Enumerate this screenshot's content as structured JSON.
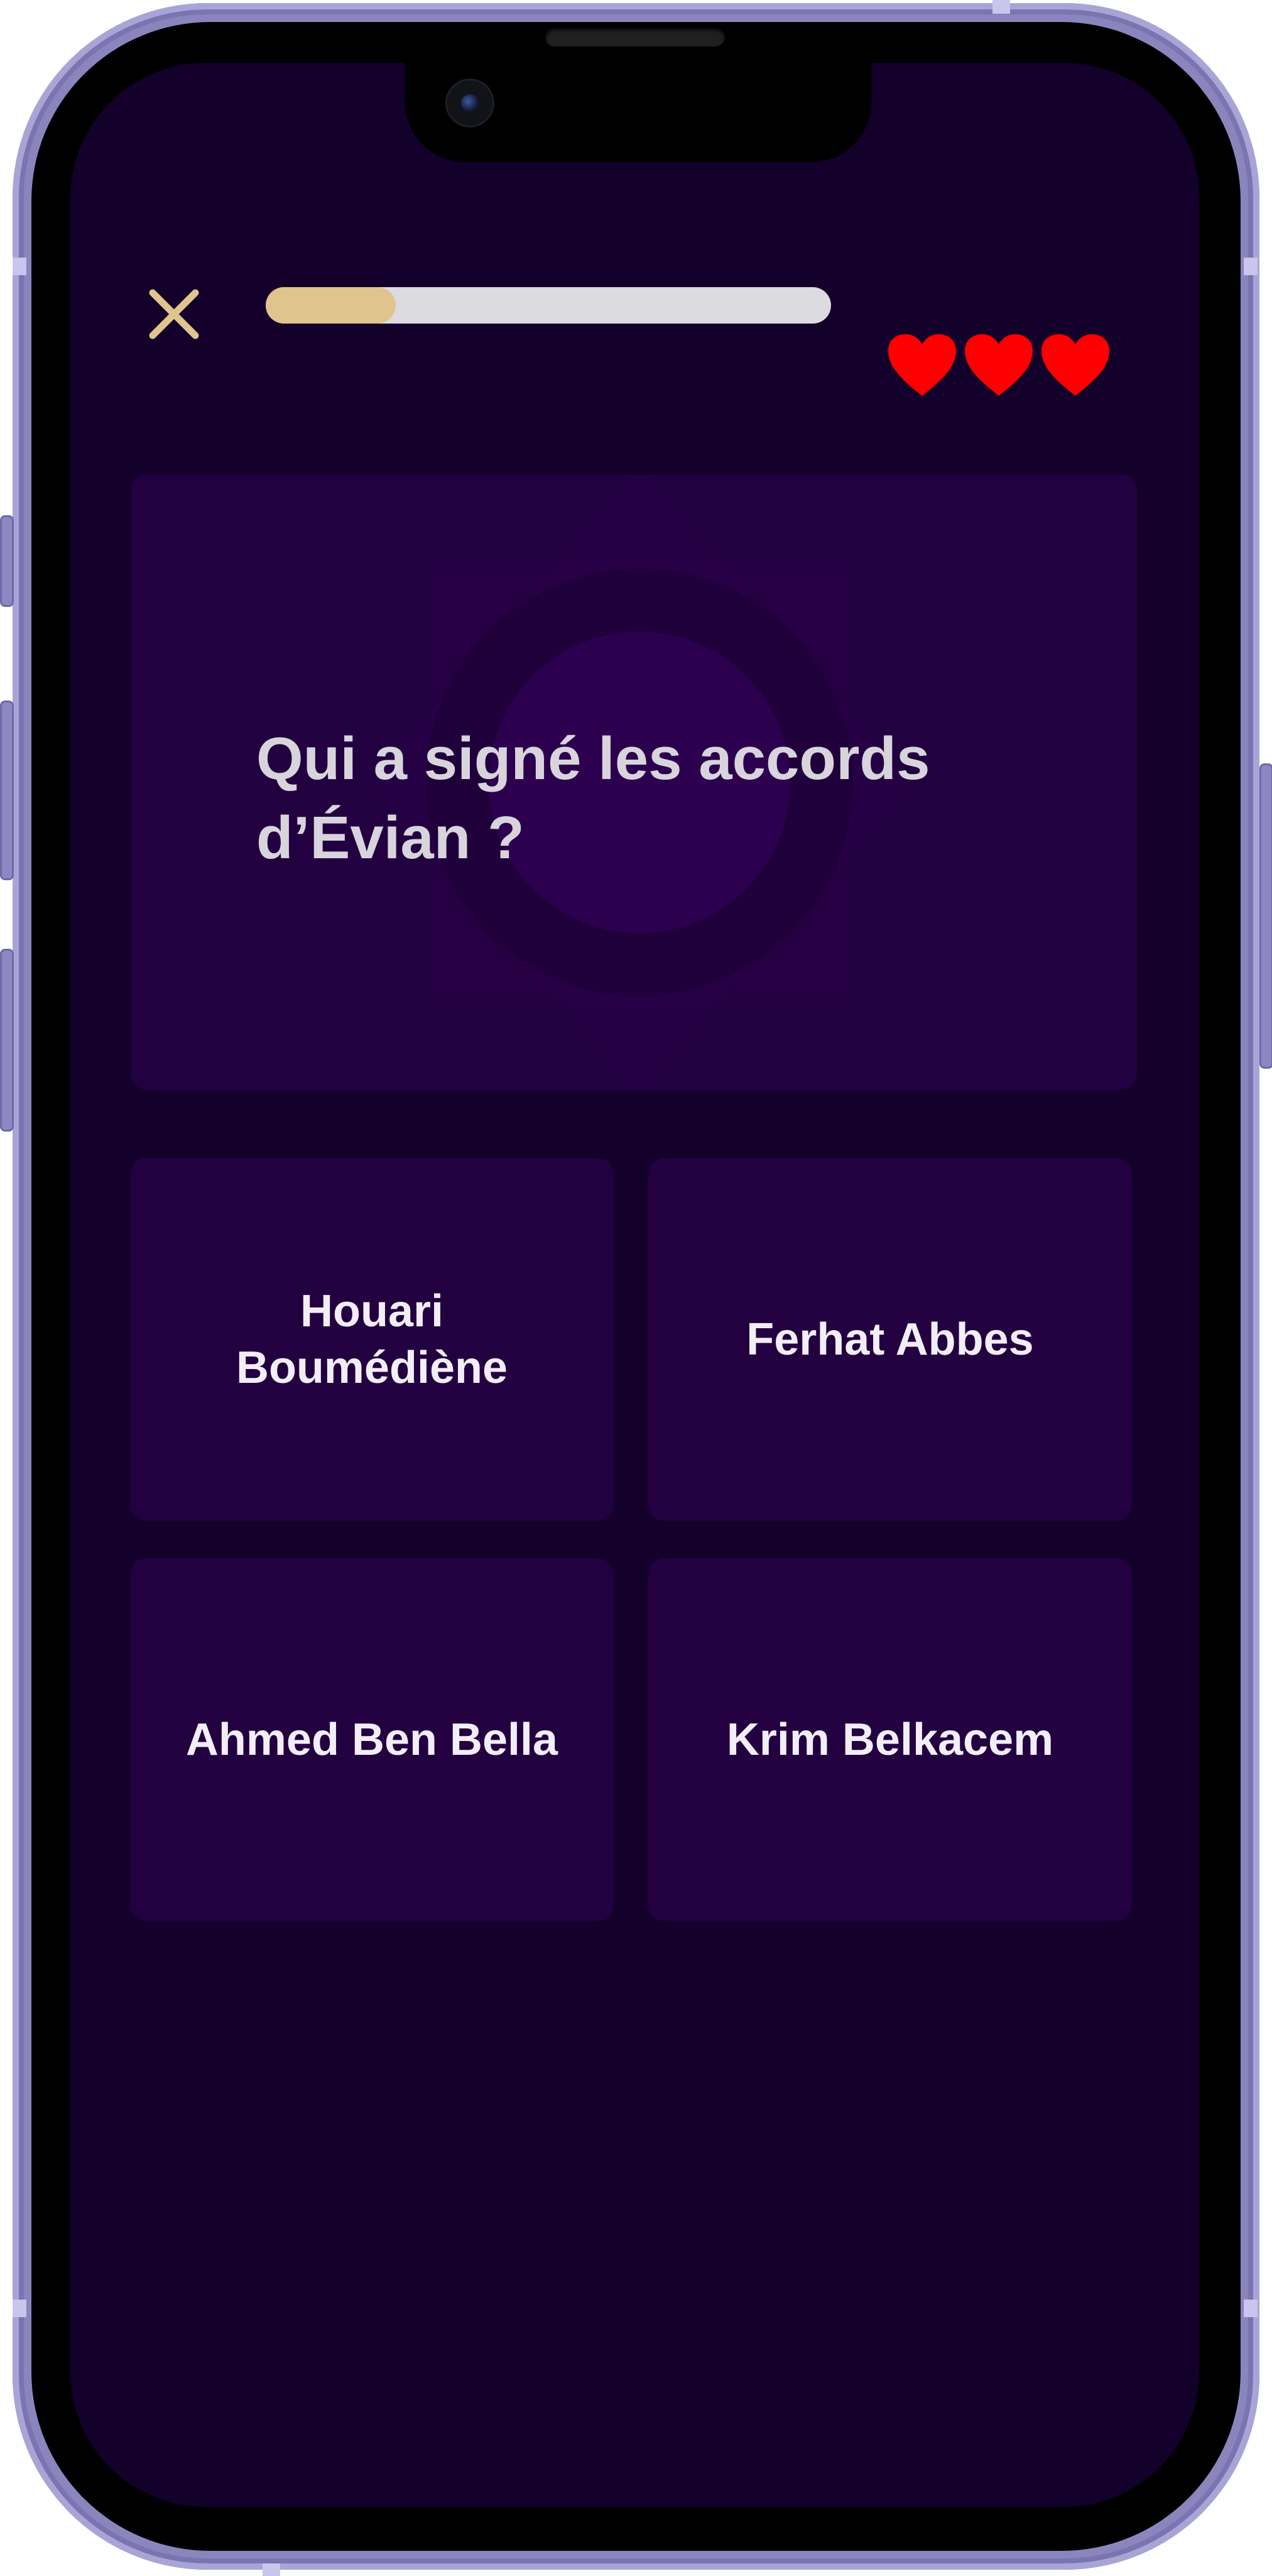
{
  "app": {
    "colors": {
      "screen_background": "#13002b",
      "card_background": "#230040",
      "accent_gold": "#dfc48e",
      "heart_red": "#ff0000",
      "progress_track": "#dcdbe0",
      "phone_frame": "#8b85be"
    }
  },
  "top_bar": {
    "close_icon": "close-x-icon",
    "progress": 0.23,
    "lives": [
      {
        "icon": "heart-icon",
        "filled": true
      },
      {
        "icon": "heart-icon",
        "filled": true
      },
      {
        "icon": "heart-icon",
        "filled": true
      }
    ]
  },
  "question": {
    "text": "Qui a signé les accords d’Évian ?",
    "background_icon": "star-emblem-icon"
  },
  "answers": [
    {
      "label": "Houari Boumédiène"
    },
    {
      "label": "Ferhat Abbes"
    },
    {
      "label": "Ahmed Ben Bella"
    },
    {
      "label": "Krim Belkacem"
    }
  ]
}
